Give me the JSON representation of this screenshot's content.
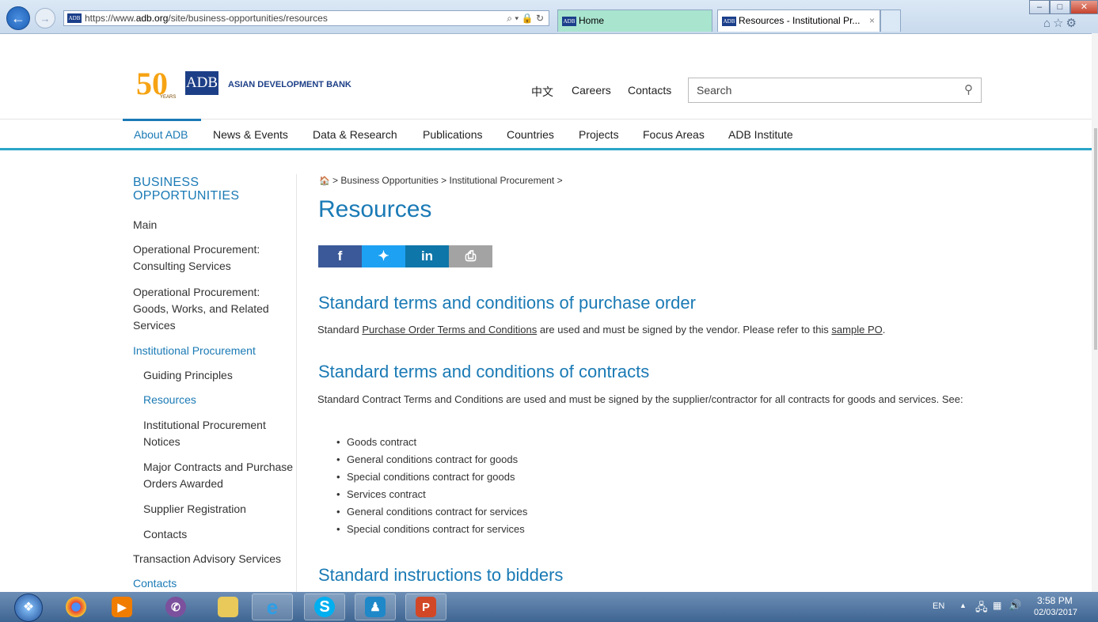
{
  "browser": {
    "url_prefix": "https://www.",
    "url_domain": "adb.org",
    "url_path": "/site/business-opportunities/resources",
    "url_tools": "⌕ ▾ 🔒 ↻",
    "favicon_text": "ADB",
    "tabs": [
      {
        "label": "Home"
      },
      {
        "label": "Resources - Institutional Pr..."
      }
    ],
    "tab_close": "×",
    "window_buttons": {
      "minimize": "–",
      "maximize": "□",
      "close": "✕"
    }
  },
  "site": {
    "logo_50": "50",
    "logo_years": "YEARS",
    "logo_box": "ADB",
    "logo_name": "ASIAN DEVELOPMENT BANK",
    "top_links": {
      "chinese": "中文",
      "careers": "Careers",
      "contacts": "Contacts"
    },
    "search_placeholder": "Search",
    "nav": [
      "About ADB",
      "News & Events",
      "Data & Research",
      "Publications",
      "Countries",
      "Projects",
      "Focus Areas",
      "ADB Institute"
    ]
  },
  "sidebar": {
    "title": "BUSINESS OPPORTUNITIES",
    "items": [
      {
        "label": "Main"
      },
      {
        "label": "Operational Procurement: Consulting Services"
      },
      {
        "label": "Operational Procurement: Goods, Works, and Related Services"
      },
      {
        "label": "Institutional Procurement"
      },
      {
        "label": "Guiding Principles"
      },
      {
        "label": "Resources"
      },
      {
        "label": "Institutional Procurement Notices"
      },
      {
        "label": "Major Contracts and Purchase Orders Awarded"
      },
      {
        "label": "Supplier Registration"
      },
      {
        "label": "Contacts"
      },
      {
        "label": "Transaction Advisory Services"
      },
      {
        "label": "Contacts"
      }
    ]
  },
  "content": {
    "breadcrumb": {
      "home_icon": "🏠",
      "sep": ">",
      "items": [
        "Business Opportunities",
        "Institutional Procurement"
      ]
    },
    "title": "Resources",
    "share": [
      {
        "icon": "f",
        "color": "#3b5998"
      },
      {
        "icon": "t",
        "color": "#1da1f2"
      },
      {
        "icon": "in",
        "color": "#0e76a8"
      },
      {
        "icon": "print",
        "color": "#a3a3a3"
      }
    ],
    "sections": [
      {
        "heading": "Standard terms and conditions of purchase order",
        "text_1": "Standard ",
        "link_1": "Purchase Order Terms and Conditions",
        "text_2": " are used and must be signed by the vendor. Please refer to this ",
        "link_2": "sample PO",
        "text_3": "."
      },
      {
        "heading": "Standard terms and conditions of contracts",
        "text": "Standard Contract Terms and Conditions are used and must be signed by the supplier/contractor for all contracts for goods and services. See:",
        "bullets": [
          "Goods contract",
          "General conditions contract for goods",
          "Special conditions contract for goods",
          "Services contract",
          "General conditions contract for services",
          "Special conditions contract for services"
        ]
      },
      {
        "heading": "Standard instructions to bidders"
      }
    ]
  },
  "taskbar": {
    "lang": "EN",
    "time": "3:58 PM",
    "date": "02/03/2017",
    "tray_arrow": "▲"
  }
}
